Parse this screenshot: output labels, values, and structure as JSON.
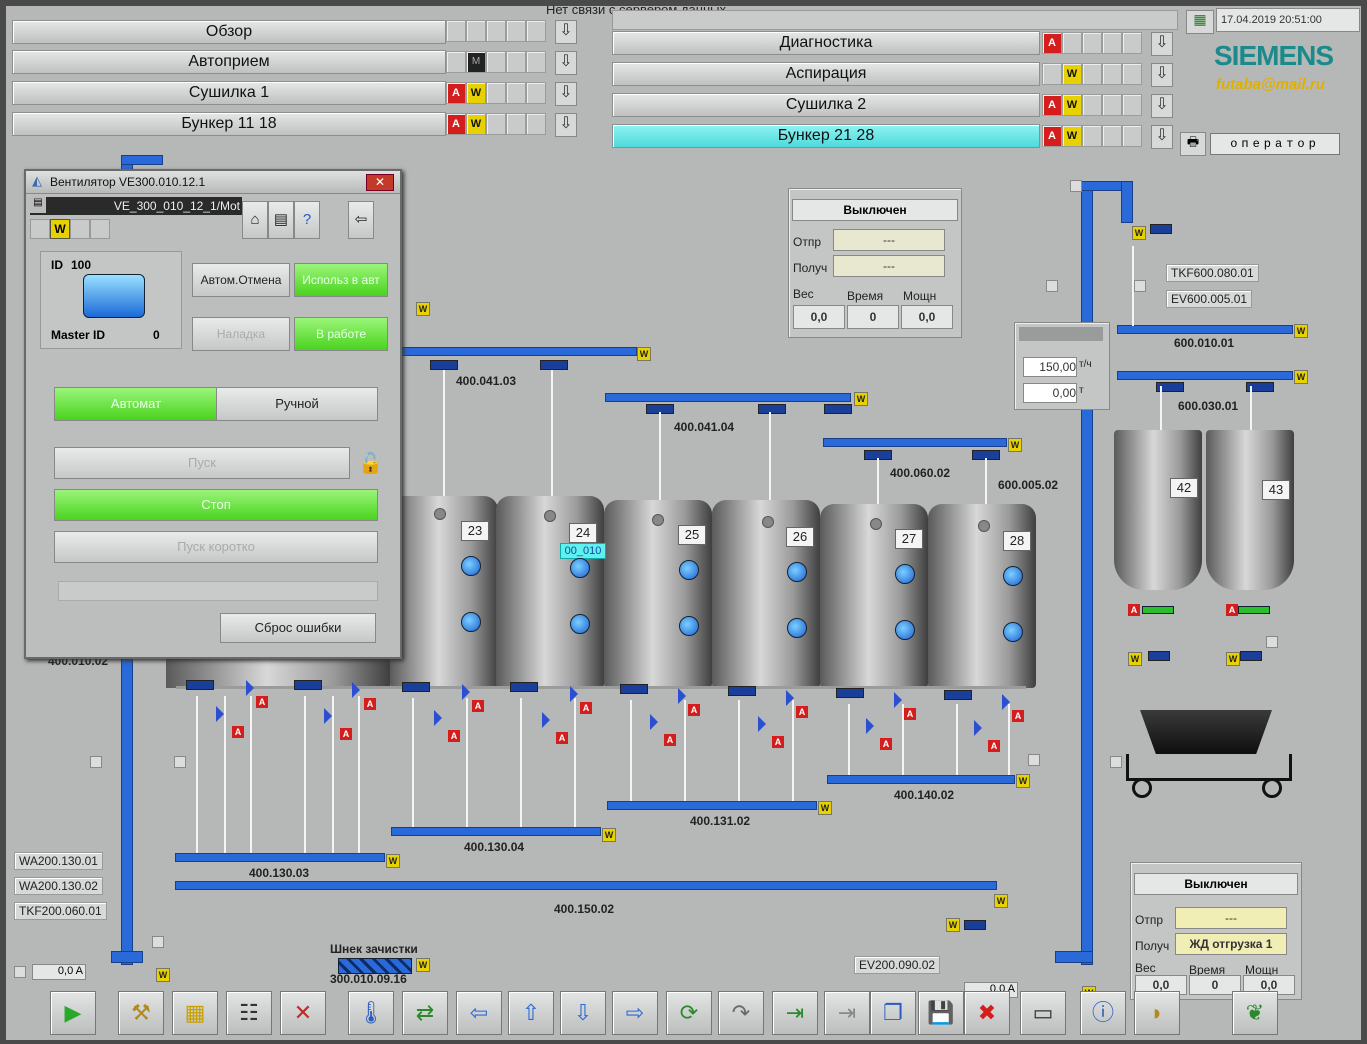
{
  "status_message": "Нет связи с сервером данных.",
  "datetime": "17.04.2019 20:51:00",
  "brand": "SIEMENS",
  "watermark": "futaba@mail.ru",
  "user": "оператор",
  "nav_left": [
    {
      "label": "Обзор",
      "flags": []
    },
    {
      "label": "Автоприем",
      "flags": [
        "M"
      ]
    },
    {
      "label": "Сушилка 1",
      "flags": [
        "A",
        "W"
      ]
    },
    {
      "label": "Бункер 11 18",
      "flags": [
        "A",
        "W"
      ]
    }
  ],
  "nav_right": [
    {
      "label": "Диагностика",
      "flags": [
        "A"
      ]
    },
    {
      "label": "Аспирация",
      "flags": [
        "W"
      ]
    },
    {
      "label": "Сушилка 2",
      "flags": [
        "A",
        "W"
      ]
    },
    {
      "label": "Бункер 21 28",
      "flags": [
        "A",
        "W"
      ],
      "active": true
    }
  ],
  "window": {
    "title": "Вентилятор VE300.010.12.1",
    "object_path": "VE_300_010_12_1/Mot",
    "w_flag": "W",
    "id_label": "ID",
    "id_value": "100",
    "master_label": "Master ID",
    "master_value": "0",
    "btn_auto_cancel": "Автом.Отмена",
    "btn_use_auto": "Использ в авт",
    "btn_setup": "Наладка",
    "btn_in_work": "В работе",
    "mode_auto": "Автомат",
    "mode_manual": "Ручной",
    "btn_start": "Пуск",
    "btn_stop": "Стоп",
    "btn_start_short": "Пуск коротко",
    "btn_reset": "Сброс ошибки"
  },
  "panel_center": {
    "status": "Выключен",
    "from_label": "Отпр",
    "from_value": "---",
    "to_label": "Получ",
    "to_value": "---",
    "weight_label": "Вес",
    "time_label": "Время",
    "power_label": "Мощн",
    "weight": "0,0",
    "time": "0",
    "power": "0,0"
  },
  "panel_flow": {
    "rate": "150,00",
    "rate_unit": "т/ч",
    "total": "0,00",
    "total_unit": "т"
  },
  "panel_bottom": {
    "status": "Выключен",
    "from_label": "Отпр",
    "from_value": "---",
    "to_label": "Получ",
    "to_value": "ЖД отгрузка 1",
    "weight_label": "Вес",
    "time_label": "Время",
    "power_label": "Мощн",
    "weight": "0,0",
    "time": "0",
    "power": "0,0"
  },
  "silos": [
    "23",
    "24",
    "25",
    "26",
    "27",
    "28"
  ],
  "silos_right": [
    "42",
    "43"
  ],
  "silo_tag": "00_010",
  "conveyors": {
    "c1": "400.041.03",
    "c2": "400.041.04",
    "c3": "400.060.02",
    "c4": "600.005.02",
    "c5": "400.010.02",
    "c6": "400.140.02",
    "c7": "400.131.02",
    "c8": "400.130.04",
    "c9": "400.130.03",
    "c10": "400.150.02",
    "c11": "600.010.01",
    "c12": "600.030.01"
  },
  "tags": {
    "tkf600": "TKF600.080.01",
    "ev600": "EV600.005.01",
    "wa1": "WA200.130.01",
    "wa2": "WA200.130.02",
    "tkf200": "TKF200.060.01",
    "ev200": "EV200.090.02"
  },
  "screw_label": "Шнек зачистки",
  "screw_tag": "300.010.09.16",
  "amp_left": "0,0 A",
  "amp_right": "0,0 A",
  "toolbar": [
    "play-icon",
    "tools-icon",
    "report-icon",
    "list-icon",
    "trend-icon",
    "thermometer-icon",
    "transfer-icon",
    "arrow-left-icon",
    "arrow-up-icon",
    "arrow-down-icon",
    "arrow-right-icon",
    "refresh-icon",
    "redo-icon",
    "import-icon",
    "export-icon",
    "copy-icon",
    "save-icon",
    "delete-icon",
    "screen-icon",
    "info-icon",
    "sound-icon",
    "plant-icon"
  ]
}
